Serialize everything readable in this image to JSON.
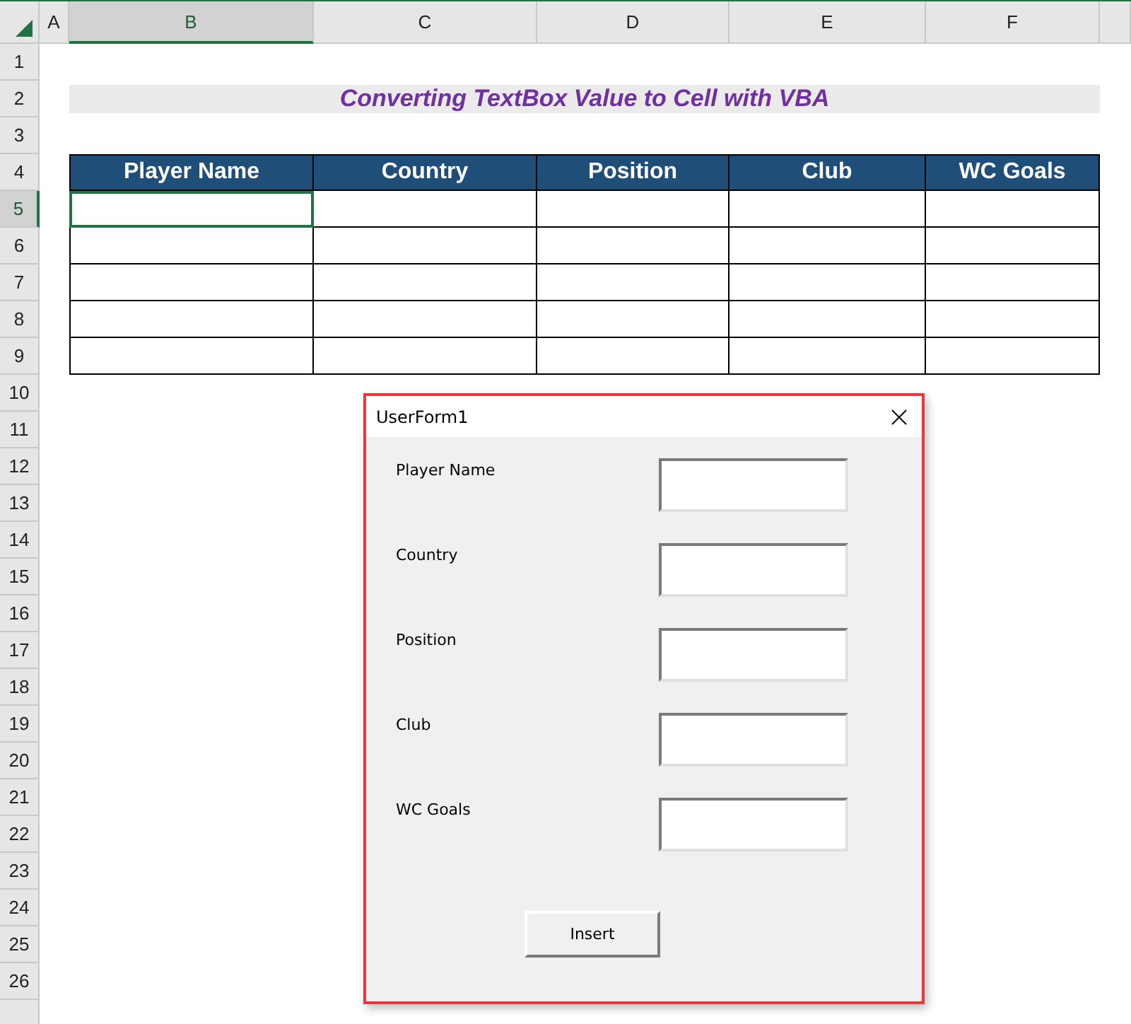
{
  "sheet": {
    "columns": [
      {
        "label": "A",
        "selected": false
      },
      {
        "label": "B",
        "selected": true
      },
      {
        "label": "C",
        "selected": false
      },
      {
        "label": "D",
        "selected": false
      },
      {
        "label": "E",
        "selected": false
      },
      {
        "label": "F",
        "selected": false
      }
    ],
    "row_headers": [
      {
        "label": "1",
        "selected": false
      },
      {
        "label": "2",
        "selected": false
      },
      {
        "label": "3",
        "selected": false
      },
      {
        "label": "4",
        "selected": false
      },
      {
        "label": "5",
        "selected": true
      },
      {
        "label": "6",
        "selected": false
      },
      {
        "label": "7",
        "selected": false
      },
      {
        "label": "8",
        "selected": false
      },
      {
        "label": "9",
        "selected": false
      },
      {
        "label": "10",
        "selected": false
      },
      {
        "label": "11",
        "selected": false
      },
      {
        "label": "12",
        "selected": false
      },
      {
        "label": "13",
        "selected": false
      },
      {
        "label": "14",
        "selected": false
      },
      {
        "label": "15",
        "selected": false
      },
      {
        "label": "16",
        "selected": false
      },
      {
        "label": "17",
        "selected": false
      },
      {
        "label": "18",
        "selected": false
      },
      {
        "label": "19",
        "selected": false
      },
      {
        "label": "20",
        "selected": false
      },
      {
        "label": "21",
        "selected": false
      },
      {
        "label": "22",
        "selected": false
      },
      {
        "label": "23",
        "selected": false
      },
      {
        "label": "24",
        "selected": false
      },
      {
        "label": "25",
        "selected": false
      },
      {
        "label": "26",
        "selected": false
      }
    ],
    "title": "Converting TextBox Value to Cell with VBA",
    "table": {
      "columns": [
        "Player Name",
        "Country",
        "Position",
        "Club",
        "WC Goals"
      ],
      "rows": [
        {
          "cells": [
            {
              "selected": true
            },
            {
              "selected": false
            },
            {
              "selected": false
            },
            {
              "selected": false
            },
            {
              "selected": false
            }
          ]
        },
        {
          "cells": [
            {
              "selected": false
            },
            {
              "selected": false
            },
            {
              "selected": false
            },
            {
              "selected": false
            },
            {
              "selected": false
            }
          ]
        },
        {
          "cells": [
            {
              "selected": false
            },
            {
              "selected": false
            },
            {
              "selected": false
            },
            {
              "selected": false
            },
            {
              "selected": false
            }
          ]
        },
        {
          "cells": [
            {
              "selected": false
            },
            {
              "selected": false
            },
            {
              "selected": false
            },
            {
              "selected": false
            },
            {
              "selected": false
            }
          ]
        },
        {
          "cells": [
            {
              "selected": false
            },
            {
              "selected": false
            },
            {
              "selected": false
            },
            {
              "selected": false
            },
            {
              "selected": false
            }
          ]
        }
      ]
    }
  },
  "dialog": {
    "title": "UserForm1",
    "fields": [
      {
        "label": "Player Name"
      },
      {
        "label": "Country"
      },
      {
        "label": "Position"
      },
      {
        "label": "Club"
      },
      {
        "label": "WC Goals"
      }
    ],
    "button": "Insert"
  }
}
